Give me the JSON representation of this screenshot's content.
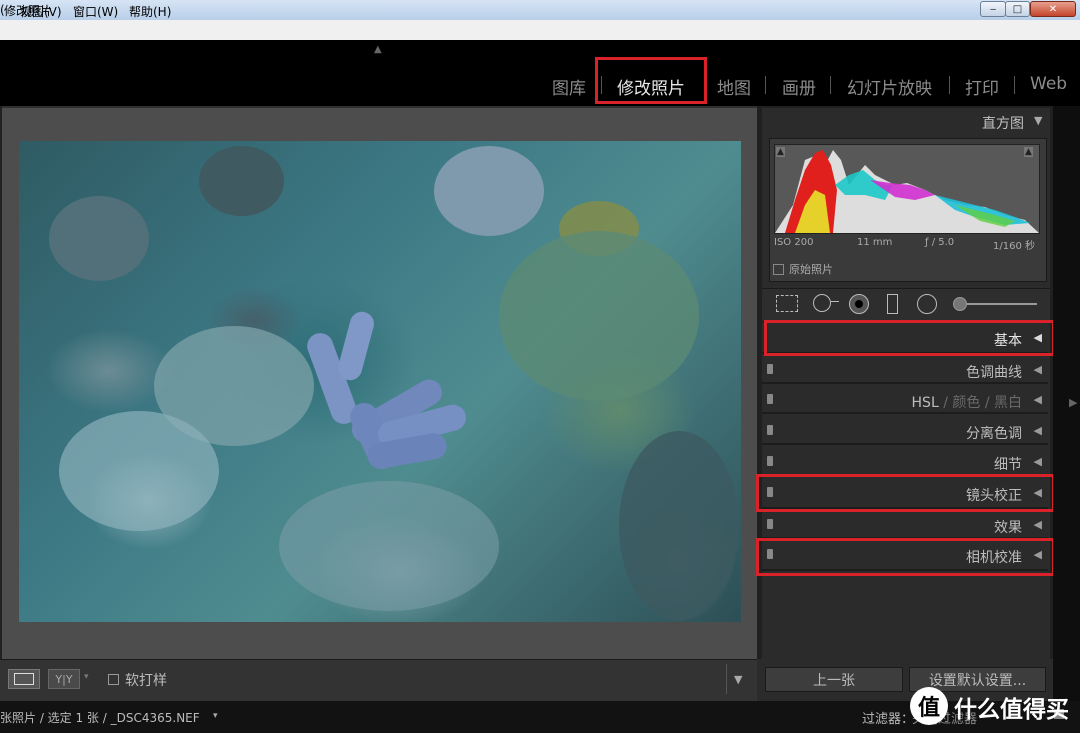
{
  "window": {
    "title": "修改照片",
    "buttons": {
      "minimize": "‒",
      "maximize": "□",
      "close": "✕"
    }
  },
  "menu": {
    "items": [
      "(",
      "视图(V)",
      "窗口(W)",
      "帮助(H)"
    ]
  },
  "modules": {
    "items": [
      "图库",
      "修改照片",
      "地图",
      "画册",
      "幻灯片放映",
      "打印",
      "Web"
    ],
    "active": "修改照片",
    "highlight_color": "#d9222a"
  },
  "histogram": {
    "title": "直方图",
    "exif": {
      "iso": "ISO 200",
      "focal": "11 mm",
      "aperture": "ƒ / 5.0",
      "shutter": "1/160 秒"
    },
    "original_label": "原始照片"
  },
  "panels": {
    "basic": "基本",
    "tone_curve": "色调曲线",
    "hsl": {
      "hsl": "HSL",
      "sep": "/",
      "color": "颜色",
      "bw": "黑白"
    },
    "split_toning": "分离色调",
    "detail": "细节",
    "lens": "镜头校正",
    "effects": "效果",
    "camera": "相机校准",
    "collapse_glyph": "◀"
  },
  "toolbar": {
    "yy_label": "Y|Y",
    "soft_proof": "软打样",
    "dropdown": "▾"
  },
  "buttons": {
    "previous": "上一张",
    "reset": "设置默认设置..."
  },
  "filmstrip": {
    "info": "张照片 / 选定 1 张 / _DSC4365.NEF",
    "filter_label": "过滤器：",
    "filter_value": "关闭过滤器"
  },
  "watermark": {
    "logo": "值",
    "text": "什么值得买"
  },
  "histogram_stats": {
    "clip_shadow": "▲",
    "clip_highlight": "▲"
  }
}
